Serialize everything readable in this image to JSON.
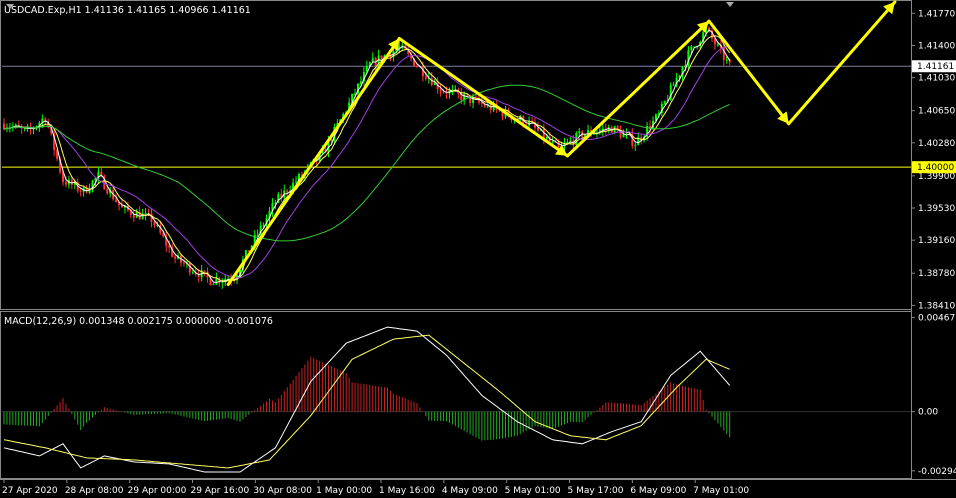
{
  "header": {
    "symbol_line": "USDCAD.Exp,H1  1.41136 1.41165 1.40966 1.41161",
    "macd_line": "MACD(12,26,9) 0.001348 0.002175 0.000000 -0.001076"
  },
  "colors": {
    "background": "#000000",
    "frame": "#ffffff",
    "bull_candle": "#00ff00",
    "bear_candle": "#ff3333",
    "ma_fast": "#ffffff",
    "ma_mid": "#ffff66",
    "ma_slow_purple": "#a040e0",
    "ma_long_green": "#33cc33",
    "level_line": "#ffff00",
    "arrows": "#ffff00",
    "current_price_line": "#8080a0",
    "hist_up": "#cc2222",
    "hist_down": "#22aa22",
    "signal_line": "#ffff66"
  },
  "chart_data": [
    {
      "type": "candlestick",
      "title": "USDCAD.Exp,H1",
      "ohlc_header": {
        "open": 1.41136,
        "high": 1.41165,
        "low": 1.40966,
        "close": 1.41161
      },
      "x_tick_labels": [
        "27 Apr 2020",
        "28 Apr 08:00",
        "29 Apr 00:00",
        "29 Apr 16:00",
        "30 Apr 08:00",
        "1 May 00:00",
        "1 May 16:00",
        "4 May 09:00",
        "5 May 01:00",
        "5 May 17:00",
        "6 May 09:00",
        "7 May 01:00"
      ],
      "y_tick_labels": [
        "1.41770",
        "1.41400",
        "1.41030",
        "1.40650",
        "1.40280",
        "1.39900",
        "1.39530",
        "1.39160",
        "1.38780",
        "1.38410"
      ],
      "ylim": [
        1.3838,
        1.419
      ],
      "current_price": 1.41161,
      "horizontal_level": 1.4,
      "price_path_anchors": [
        {
          "x": 0,
          "price": 1.405
        },
        {
          "x": 8,
          "price": 1.404
        },
        {
          "x": 14,
          "price": 1.4058
        },
        {
          "x": 20,
          "price": 1.3985
        },
        {
          "x": 27,
          "price": 1.3972
        },
        {
          "x": 32,
          "price": 1.399
        },
        {
          "x": 40,
          "price": 1.3952
        },
        {
          "x": 50,
          "price": 1.394
        },
        {
          "x": 58,
          "price": 1.3895
        },
        {
          "x": 70,
          "price": 1.387
        },
        {
          "x": 78,
          "price": 1.3874
        },
        {
          "x": 92,
          "price": 1.396
        },
        {
          "x": 108,
          "price": 1.4015
        },
        {
          "x": 124,
          "price": 1.4118
        },
        {
          "x": 134,
          "price": 1.4138
        },
        {
          "x": 148,
          "price": 1.409
        },
        {
          "x": 164,
          "price": 1.407
        },
        {
          "x": 178,
          "price": 1.405
        },
        {
          "x": 188,
          "price": 1.402
        },
        {
          "x": 196,
          "price": 1.4038
        },
        {
          "x": 206,
          "price": 1.4045
        },
        {
          "x": 214,
          "price": 1.4028
        },
        {
          "x": 222,
          "price": 1.406
        },
        {
          "x": 232,
          "price": 1.413
        },
        {
          "x": 238,
          "price": 1.4158
        },
        {
          "x": 246,
          "price": 1.4116
        }
      ],
      "projection_arrows": [
        {
          "from": {
            "x": 76,
            "price": 1.3865
          },
          "to": {
            "x": 134,
            "price": 1.4148
          }
        },
        {
          "from": {
            "x": 134,
            "price": 1.4148
          },
          "to": {
            "x": 191,
            "price": 1.4013
          }
        },
        {
          "from": {
            "x": 191,
            "price": 1.4013
          },
          "to": {
            "x": 239,
            "price": 1.4168
          }
        },
        {
          "from": {
            "x": 239,
            "price": 1.4168
          },
          "to": {
            "x": 266,
            "price": 1.405
          }
        },
        {
          "from": {
            "x": 266,
            "price": 1.405
          },
          "to": {
            "x": 302,
            "price": 1.419
          }
        }
      ]
    },
    {
      "type": "histogram",
      "title": "MACD(12,26,9)",
      "values_header": {
        "macd": 0.001348,
        "signal": 0.002175,
        "c": 0.0,
        "d": -0.001076
      },
      "y_tick_labels": [
        "0.00467",
        "0.00",
        "-0.002942"
      ],
      "ylim": [
        -0.0033,
        0.0049
      ],
      "macd_anchors": [
        {
          "x": 0,
          "v": -0.0018
        },
        {
          "x": 12,
          "v": -0.0022
        },
        {
          "x": 20,
          "v": -0.0016
        },
        {
          "x": 26,
          "v": -0.0028
        },
        {
          "x": 34,
          "v": -0.0022
        },
        {
          "x": 44,
          "v": -0.0025
        },
        {
          "x": 56,
          "v": -0.0026
        },
        {
          "x": 68,
          "v": -0.003
        },
        {
          "x": 80,
          "v": -0.003
        },
        {
          "x": 92,
          "v": -0.0018
        },
        {
          "x": 104,
          "v": 0.0015
        },
        {
          "x": 116,
          "v": 0.0034
        },
        {
          "x": 130,
          "v": 0.0042
        },
        {
          "x": 140,
          "v": 0.004
        },
        {
          "x": 150,
          "v": 0.0028
        },
        {
          "x": 162,
          "v": 0.0008
        },
        {
          "x": 174,
          "v": -0.0005
        },
        {
          "x": 186,
          "v": -0.0014
        },
        {
          "x": 196,
          "v": -0.0016
        },
        {
          "x": 206,
          "v": -0.001
        },
        {
          "x": 216,
          "v": -0.0005
        },
        {
          "x": 226,
          "v": 0.0018
        },
        {
          "x": 236,
          "v": 0.003
        },
        {
          "x": 246,
          "v": 0.0013
        }
      ],
      "signal_anchors": [
        {
          "x": 0,
          "v": -0.0014
        },
        {
          "x": 14,
          "v": -0.0018
        },
        {
          "x": 28,
          "v": -0.0023
        },
        {
          "x": 44,
          "v": -0.0024
        },
        {
          "x": 60,
          "v": -0.0026
        },
        {
          "x": 76,
          "v": -0.0028
        },
        {
          "x": 90,
          "v": -0.0024
        },
        {
          "x": 104,
          "v": -0.0002
        },
        {
          "x": 118,
          "v": 0.0026
        },
        {
          "x": 132,
          "v": 0.0036
        },
        {
          "x": 144,
          "v": 0.0038
        },
        {
          "x": 156,
          "v": 0.0024
        },
        {
          "x": 168,
          "v": 0.001
        },
        {
          "x": 180,
          "v": -0.0005
        },
        {
          "x": 192,
          "v": -0.0012
        },
        {
          "x": 204,
          "v": -0.0014
        },
        {
          "x": 216,
          "v": -0.0007
        },
        {
          "x": 228,
          "v": 0.0012
        },
        {
          "x": 238,
          "v": 0.0026
        },
        {
          "x": 246,
          "v": 0.0021
        }
      ]
    }
  ]
}
